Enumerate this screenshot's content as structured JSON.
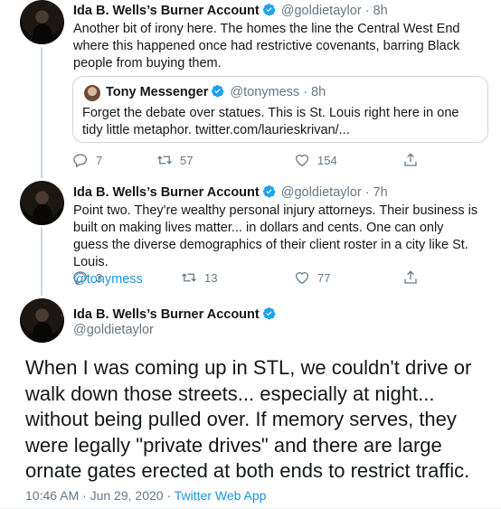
{
  "tweet1": {
    "name": "Ida B. Wells’s Burner Account",
    "handle": "@goldietaylor",
    "time": "· 8h",
    "text": "Another bit of irony here. The homes the line the Central West End where this happened once had restrictive covenants, barring Black people from buying them.",
    "quote": {
      "name": "Tony Messenger",
      "handle": "@tonymess",
      "time": "· 8h",
      "text": "Forget the debate over statues. This is St. Louis right here in one tidy little metaphor. twitter.com/laurieskrivan/..."
    },
    "actions": {
      "replies": "7",
      "retweets": "57",
      "likes": "154"
    }
  },
  "tweet2": {
    "name": "Ida B. Wells’s Burner Account",
    "handle": "@goldietaylor",
    "time": "· 7h",
    "text": "Point two. They're wealthy personal injury attorneys. Their business is built on making lives matter... in dollars and cents. One can only guess the diverse demographics of their client roster in a city like St. Louis.",
    "mention": "@tonymess",
    "actions": {
      "replies": "3",
      "retweets": "13",
      "likes": "77"
    }
  },
  "tweet3": {
    "name": "Ida B. Wells’s Burner Account",
    "handle": "@goldietaylor",
    "text": "When I was coming up in STL, we couldn't drive or walk down those streets... especially at night... without being pulled over. If memory serves, they were legally \"private drives\" and there are large ornate gates erected at both ends to restrict traffic.",
    "timestamp": "10:46 AM · Jun 29, 2020 ·",
    "source": "Twitter Web App"
  },
  "icons": {
    "verified": "verified-badge-icon",
    "reply": "reply-icon",
    "retweet": "retweet-icon",
    "like": "heart-icon",
    "share": "share-icon"
  },
  "colors": {
    "link": "#1b95e0",
    "muted": "#657786",
    "verified": "#1da1f2"
  }
}
